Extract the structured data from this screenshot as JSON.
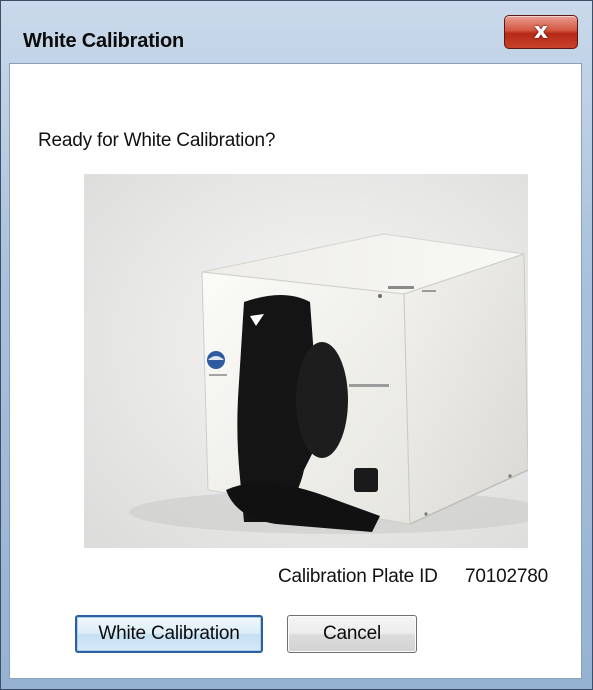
{
  "window": {
    "title": "White Calibration",
    "close_glyph": "x"
  },
  "dialog": {
    "prompt": "Ready for White Calibration?",
    "plate_label": "Calibration Plate ID",
    "plate_id": "70102780"
  },
  "buttons": {
    "primary_label": "White Calibration",
    "cancel_label": "Cancel"
  },
  "image": {
    "subject": "spectrophotometer-with-calibration-plate",
    "photo_background_color": "#ececeb",
    "device_color": "#f4f3ee",
    "plate_holder_color": "#141414"
  },
  "colors": {
    "title_bar": "#b7cce3",
    "close_button": "#c8402a",
    "primary_button_border": "#2f5f9b"
  }
}
